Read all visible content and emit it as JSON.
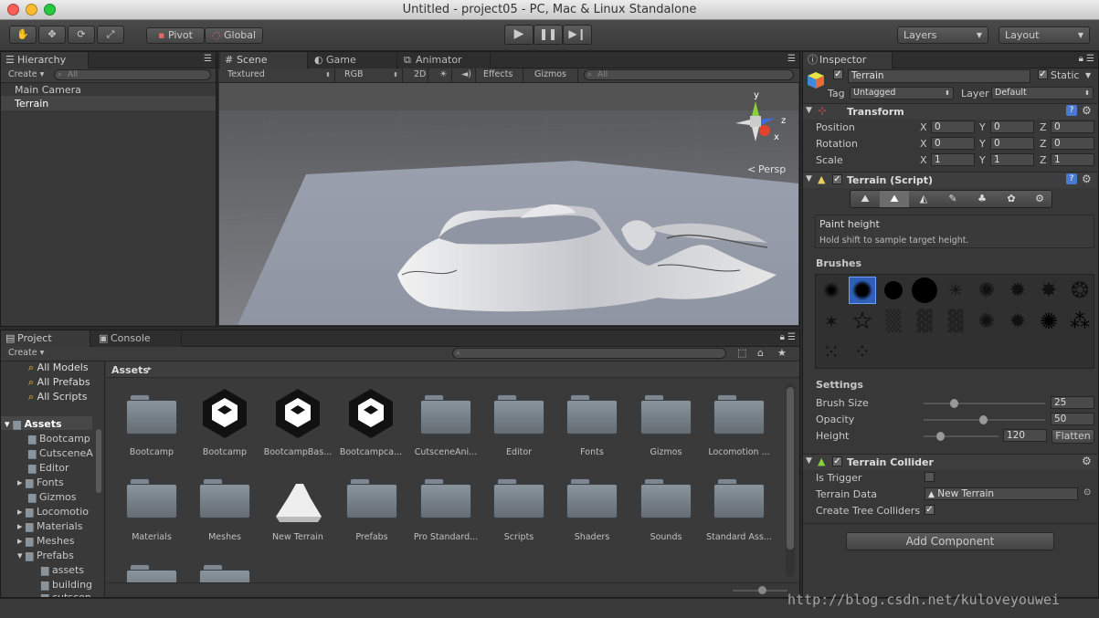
{
  "window": {
    "title": "Untitled - project05 - PC, Mac & Linux Standalone"
  },
  "toolbar": {
    "pivot_label": "Pivot",
    "global_label": "Global",
    "layers_label": "Layers",
    "layout_label": "Layout"
  },
  "hierarchy": {
    "tab_label": "Hierarchy",
    "create_label": "Create",
    "search_placeholder": "All",
    "items": [
      "Main Camera",
      "Terrain"
    ]
  },
  "scene": {
    "tabs": [
      "Scene",
      "Game",
      "Animator"
    ],
    "render_mode": "Textured",
    "color_mode": "RGB",
    "mode_2d": "2D",
    "effects_label": "Effects",
    "gizmos_label": "Gizmos",
    "search_placeholder": "All",
    "persp_label": "Persp",
    "axis_labels": {
      "x": "x",
      "y": "y",
      "z": "z"
    }
  },
  "project": {
    "tabs": [
      "Project",
      "Console"
    ],
    "create_label": "Create",
    "favorites": [
      "All Models",
      "All Prefabs",
      "All Scripts"
    ],
    "tree": [
      "Assets",
      "Bootcamp",
      "CutsceneA",
      "Editor",
      "Fonts",
      "Gizmos",
      "Locomotio",
      "Materials",
      "Meshes",
      "Prefabs",
      "assets",
      "building",
      "cutscen"
    ],
    "breadcrumb": "Assets",
    "assets_row1": [
      "Bootcamp",
      "Bootcamp",
      "BootcampBas...",
      "Bootcampca...",
      "CutsceneAni...",
      "Editor",
      "Fonts",
      "Gizmos",
      "Locomotion ..."
    ],
    "assets_row2": [
      "Materials",
      "Meshes",
      "New Terrain",
      "Prefabs",
      "Pro Standard...",
      "Scripts",
      "Shaders",
      "Sounds",
      "Standard Ass..."
    ]
  },
  "inspector": {
    "tab_label": "Inspector",
    "object_name": "Terrain",
    "static_label": "Static",
    "tag_label": "Tag",
    "tag_value": "Untagged",
    "layer_label": "Layer",
    "layer_value": "Default",
    "transform": {
      "title": "Transform",
      "rows": [
        {
          "label": "Position",
          "x": "0",
          "y": "0",
          "z": "0"
        },
        {
          "label": "Rotation",
          "x": "0",
          "y": "0",
          "z": "0"
        },
        {
          "label": "Scale",
          "x": "1",
          "y": "1",
          "z": "1"
        }
      ],
      "axis": {
        "x": "X",
        "y": "Y",
        "z": "Z"
      }
    },
    "terrain_script": {
      "title": "Terrain (Script)",
      "tool_title": "Paint height",
      "tool_hint": "Hold shift to sample target height.",
      "brushes_label": "Brushes",
      "settings_label": "Settings",
      "brush_size_label": "Brush Size",
      "brush_size_value": "25",
      "opacity_label": "Opacity",
      "opacity_value": "50",
      "height_label": "Height",
      "height_value": "120",
      "flatten_label": "Flatten"
    },
    "terrain_collider": {
      "title": "Terrain Collider",
      "is_trigger_label": "Is Trigger",
      "terrain_data_label": "Terrain Data",
      "terrain_data_value": "New Terrain",
      "create_tree_label": "Create Tree Colliders"
    },
    "add_component_label": "Add Component"
  },
  "watermark": "http://blog.csdn.net/kuloveyouwei"
}
